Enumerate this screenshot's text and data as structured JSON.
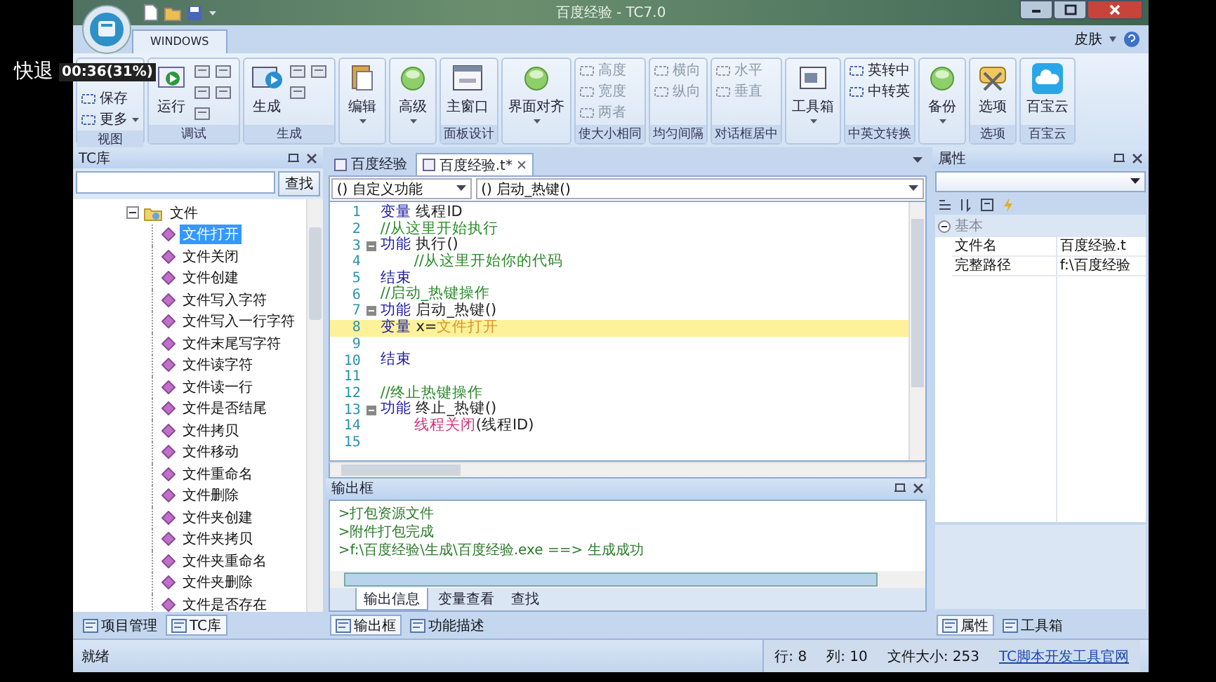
{
  "osd": {
    "action": "快退",
    "time": "00:36(31%)"
  },
  "window": {
    "title": "百度经验 - TC7.0"
  },
  "ribbon": {
    "tabs": [
      {
        "label": "WINDOWS",
        "selected": true
      }
    ],
    "skin": "皮肤",
    "groups": [
      {
        "label": "视图",
        "disabled": false,
        "buttons": [
          {
            "kind": "small",
            "label": "保存",
            "dropdown": false
          },
          {
            "kind": "small",
            "label": "更多",
            "dropdown": true
          }
        ]
      },
      {
        "label": "调试",
        "disabled": false,
        "buttons": [
          {
            "kind": "large",
            "label": "运行",
            "dropdown": false
          },
          {
            "kind": "icon"
          },
          {
            "kind": "icon"
          },
          {
            "kind": "icon"
          },
          {
            "kind": "icon"
          },
          {
            "kind": "icon"
          }
        ]
      },
      {
        "label": "生成",
        "disabled": false,
        "buttons": [
          {
            "kind": "large",
            "label": "生成",
            "dropdown": false
          },
          {
            "kind": "icon"
          },
          {
            "kind": "icon"
          },
          {
            "kind": "icon"
          }
        ]
      },
      {
        "disabled": false,
        "buttons": [
          {
            "kind": "large",
            "label": "编辑",
            "dropdown": true
          }
        ]
      },
      {
        "disabled": false,
        "buttons": [
          {
            "kind": "large",
            "label": "高级",
            "dropdown": true
          }
        ]
      },
      {
        "label": "面板设计",
        "disabled": false,
        "buttons": [
          {
            "kind": "large",
            "label": "主窗口",
            "dropdown": false
          }
        ]
      },
      {
        "disabled": false,
        "buttons": [
          {
            "kind": "large",
            "label": "界面对齐",
            "dropdown": true
          }
        ]
      },
      {
        "label": "使大小相同",
        "disabled": true,
        "buttons": [
          {
            "kind": "small",
            "label": "高度",
            "dropdown": false
          },
          {
            "kind": "small",
            "label": "宽度",
            "dropdown": false
          },
          {
            "kind": "small",
            "label": "两者",
            "dropdown": false
          }
        ]
      },
      {
        "label": "均匀间隔",
        "disabled": true,
        "buttons": [
          {
            "kind": "small",
            "label": "横向",
            "dropdown": false
          },
          {
            "kind": "small",
            "label": "纵向",
            "dropdown": false
          }
        ]
      },
      {
        "label": "对话框居中",
        "disabled": true,
        "buttons": [
          {
            "kind": "small",
            "label": "水平",
            "dropdown": false
          },
          {
            "kind": "small",
            "label": "垂直",
            "dropdown": false
          }
        ]
      },
      {
        "disabled": false,
        "buttons": [
          {
            "kind": "large",
            "label": "工具箱",
            "dropdown": true
          }
        ]
      },
      {
        "label": "中英文转换",
        "disabled": false,
        "buttons": [
          {
            "kind": "small",
            "label": "英转中",
            "dropdown": false
          },
          {
            "kind": "small",
            "label": "中转英",
            "dropdown": false
          }
        ]
      },
      {
        "disabled": false,
        "buttons": [
          {
            "kind": "large",
            "label": "备份",
            "dropdown": true
          }
        ]
      },
      {
        "label": "选项",
        "disabled": false,
        "buttons": [
          {
            "kind": "large",
            "label": "选项",
            "dropdown": false
          }
        ]
      },
      {
        "label": "百宝云",
        "disabled": false,
        "buttons": [
          {
            "kind": "large",
            "label": "百宝云",
            "dropdown": false
          }
        ]
      }
    ]
  },
  "tc_panel": {
    "title": "TC库",
    "search_button": "查找",
    "tree": [
      {
        "label": "文件",
        "expanded": true,
        "children": [
          {
            "label": "文件打开",
            "selected": true
          },
          {
            "label": "文件关闭",
            "selected": false
          },
          {
            "label": "文件创建",
            "selected": false
          },
          {
            "label": "文件写入字符",
            "selected": false
          },
          {
            "label": "文件写入一行字符",
            "selected": false
          },
          {
            "label": "文件末尾写字符",
            "selected": false
          },
          {
            "label": "文件读字符",
            "selected": false
          },
          {
            "label": "文件读一行",
            "selected": false
          },
          {
            "label": "文件是否结尾",
            "selected": false
          },
          {
            "label": "文件拷贝",
            "selected": false
          },
          {
            "label": "文件移动",
            "selected": false
          },
          {
            "label": "文件重命名",
            "selected": false
          },
          {
            "label": "文件删除",
            "selected": false
          },
          {
            "label": "文件夹创建",
            "selected": false
          },
          {
            "label": "文件夹拷贝",
            "selected": false
          },
          {
            "label": "文件夹重命名",
            "selected": false
          },
          {
            "label": "文件夹删除",
            "selected": false
          },
          {
            "label": "文件是否存在",
            "selected": false
          }
        ]
      }
    ],
    "tabs": [
      {
        "label": "项目管理",
        "selected": false
      },
      {
        "label": "TC库",
        "selected": true
      }
    ]
  },
  "editor": {
    "tabs": [
      {
        "label": "百度经验",
        "selected": false
      },
      {
        "label": "百度经验.t*",
        "selected": true
      }
    ],
    "scope_combo": "() 自定义功能",
    "function_combo": "() 启动_热键()",
    "lines": [
      {
        "number": "1",
        "fold": false,
        "current": false,
        "tokens": [
          {
            "kind": "keyword",
            "text": "变量"
          },
          {
            "kind": "plain",
            "text": " 线程ID"
          }
        ]
      },
      {
        "number": "2",
        "fold": false,
        "current": false,
        "tokens": [
          {
            "kind": "comment",
            "text": "//从这里开始执行"
          }
        ]
      },
      {
        "number": "3",
        "fold": true,
        "current": false,
        "tokens": [
          {
            "kind": "keyword",
            "text": "功能"
          },
          {
            "kind": "plain",
            "text": " 执行()"
          }
        ]
      },
      {
        "number": "4",
        "fold": false,
        "current": false,
        "indented": true,
        "tokens": [
          {
            "kind": "comment",
            "text": "//从这里开始你的代码"
          }
        ]
      },
      {
        "number": "5",
        "fold": false,
        "current": false,
        "tokens": [
          {
            "kind": "keyword",
            "text": "结束"
          }
        ]
      },
      {
        "number": "6",
        "fold": false,
        "current": false,
        "tokens": [
          {
            "kind": "comment",
            "text": "//启动_热键操作"
          }
        ]
      },
      {
        "number": "7",
        "fold": true,
        "current": false,
        "tokens": [
          {
            "kind": "keyword",
            "text": "功能"
          },
          {
            "kind": "plain",
            "text": " 启动_热键()"
          }
        ]
      },
      {
        "number": "8",
        "fold": false,
        "current": true,
        "tokens": [
          {
            "kind": "keyword",
            "text": "变量"
          },
          {
            "kind": "plain",
            "text": " x="
          },
          {
            "kind": "string",
            "text": "文件打开"
          }
        ]
      },
      {
        "number": "9",
        "fold": false,
        "current": false
      },
      {
        "number": "10",
        "fold": false,
        "current": false,
        "tokens": [
          {
            "kind": "keyword",
            "text": "结束"
          }
        ]
      },
      {
        "number": "11",
        "fold": false,
        "current": false
      },
      {
        "number": "12",
        "fold": false,
        "current": false,
        "tokens": [
          {
            "kind": "comment",
            "text": "//终止热键操作"
          }
        ]
      },
      {
        "number": "13",
        "fold": true,
        "current": false,
        "tokens": [
          {
            "kind": "keyword",
            "text": "功能"
          },
          {
            "kind": "plain",
            "text": " 终止_热键()"
          }
        ]
      },
      {
        "number": "14",
        "fold": false,
        "current": false,
        "indented": true,
        "tokens": [
          {
            "kind": "function",
            "text": "线程关闭"
          },
          {
            "kind": "plain",
            "text": "(线程ID)"
          }
        ]
      },
      {
        "number": "15",
        "fold": false,
        "current": false
      }
    ]
  },
  "properties": {
    "title": "属性",
    "category": {
      "label": "基本",
      "expanded": true
    },
    "rows": [
      {
        "name": "文件名",
        "value": "百度经验.t"
      },
      {
        "name": "完整路径",
        "value": "f:\\百度经验"
      }
    ],
    "tabs": [
      {
        "label": "属性",
        "selected": true
      },
      {
        "label": "工具箱",
        "selected": false
      }
    ]
  },
  "output": {
    "title": "输出框",
    "lines": [
      ">打包资源文件",
      ">附件打包完成",
      ">f:\\百度经验\\生成\\百度经验.exe ==> 生成成功"
    ],
    "tabs": [
      {
        "label": "输出信息",
        "selected": true
      },
      {
        "label": "变量查看",
        "selected": false
      },
      {
        "label": "查找",
        "selected": false
      }
    ],
    "bottom_tabs": [
      {
        "label": "输出框",
        "selected": true
      },
      {
        "label": "功能描述",
        "selected": false
      }
    ]
  },
  "status_bar": {
    "text": "就绪",
    "row": "行: 8",
    "column": "列: 10",
    "file_size": "文件大小: 253",
    "link": "TC脚本开发工具官网"
  }
}
